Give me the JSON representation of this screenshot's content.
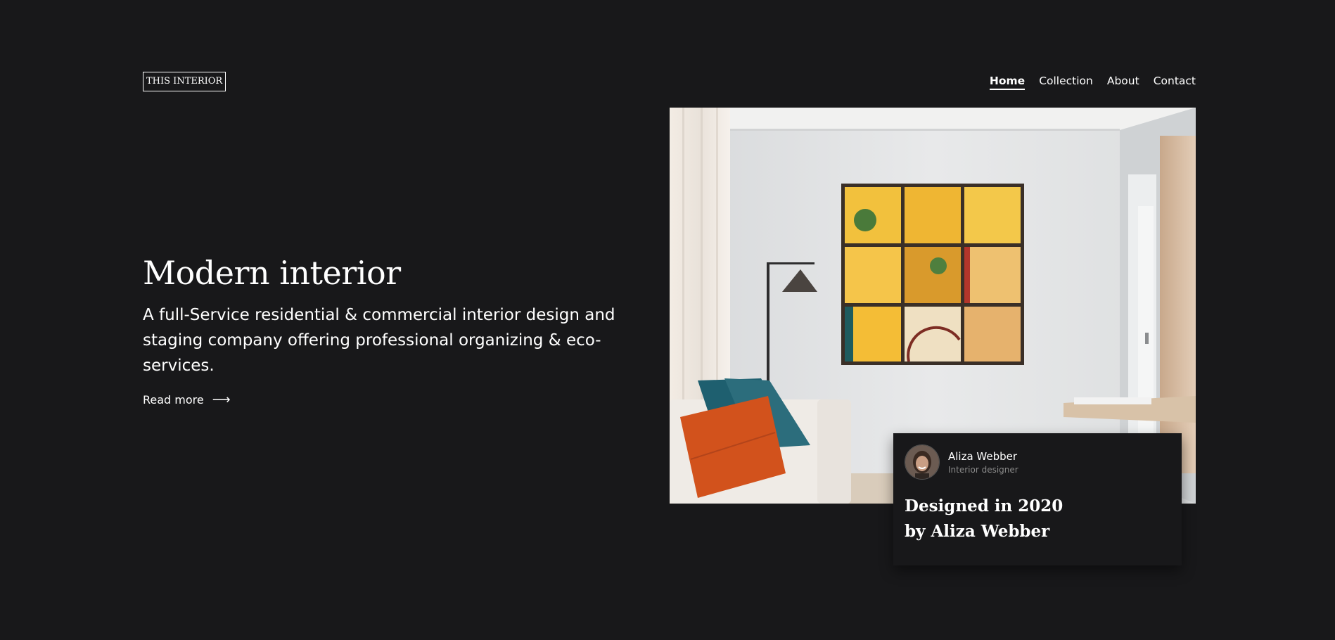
{
  "brand": {
    "logo_text": "THIS INTERIOR"
  },
  "nav": {
    "items": [
      {
        "label": "Home",
        "active": true
      },
      {
        "label": "Collection",
        "active": false
      },
      {
        "label": "About",
        "active": false
      },
      {
        "label": "Contact",
        "active": false
      }
    ]
  },
  "hero": {
    "title": "Modern interior",
    "description": "A full-Service residential & commercial interior design and staging company offering professional organizing & eco-services.",
    "read_more_label": "Read more",
    "read_more_icon": "arrow-right-icon"
  },
  "feature_image": {
    "subject": "living-room-photo"
  },
  "designer_card": {
    "name": "Aliza Webber",
    "role": "Interior designer",
    "credit": "Designed in 2020 by Aliza Webber"
  },
  "colors": {
    "background": "#18181a",
    "text": "#ffffff",
    "muted": "#8a8a8a"
  }
}
